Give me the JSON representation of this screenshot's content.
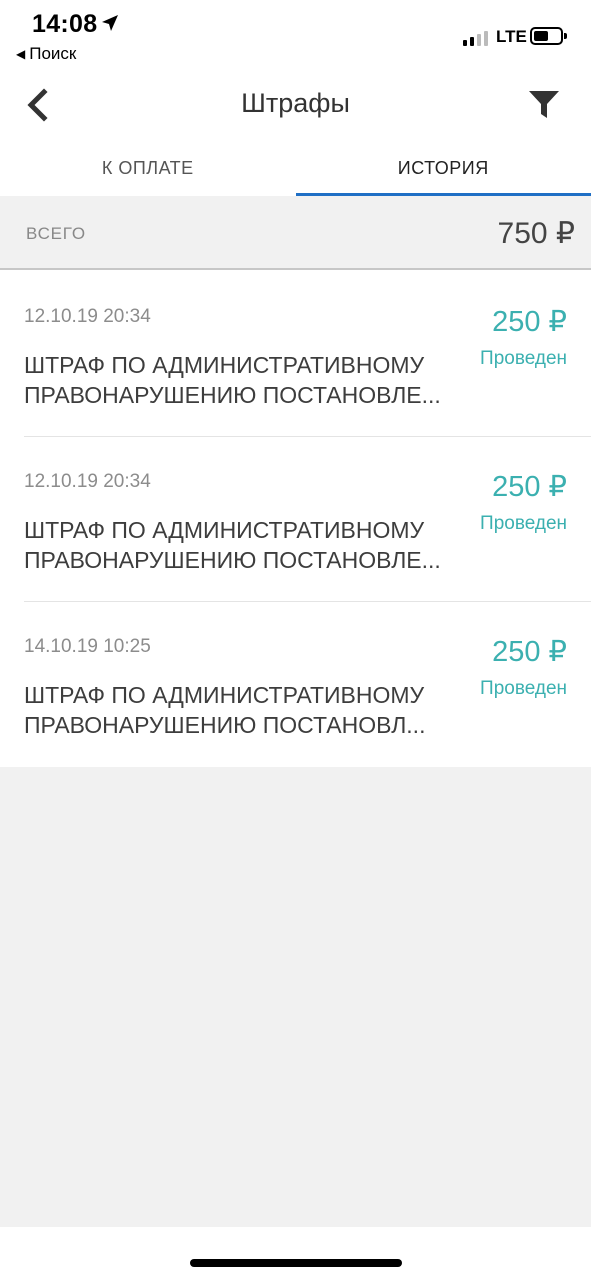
{
  "status_bar": {
    "time": "14:08",
    "back_app": "Поиск",
    "network": "LTE"
  },
  "nav": {
    "title": "Штрафы",
    "back_icon": "chevron-left-icon",
    "filter_icon": "filter-icon"
  },
  "tabs": [
    {
      "label": "К ОПЛАТЕ",
      "active": false
    },
    {
      "label": "ИСТОРИЯ",
      "active": true
    }
  ],
  "total": {
    "label": "ВСЕГО",
    "value": "750 ₽"
  },
  "fines": [
    {
      "date": "12.10.19 20:34",
      "line1": "ШТРАФ ПО АДМИНИСТРАТИВНОМУ",
      "line2": "ПРАВОНАРУШЕНИЮ ПОСТАНОВЛЕ...",
      "amount": "250 ₽",
      "status": "Проведен"
    },
    {
      "date": "12.10.19 20:34",
      "line1": "ШТРАФ ПО АДМИНИСТРАТИВНОМУ",
      "line2": "ПРАВОНАРУШЕНИЮ ПОСТАНОВЛЕ...",
      "amount": "250 ₽",
      "status": "Проведен"
    },
    {
      "date": "14.10.19 10:25",
      "line1": "ШТРАФ ПО АДМИНИСТРАТИВНОМУ",
      "line2": "ПРАВОНАРУШЕНИЮ ПОСТАНОВЛ...",
      "amount": "250 ₽",
      "status": "Проведен"
    }
  ],
  "colors": {
    "accent_teal": "#3bb0b0",
    "tab_indicator": "#1f6fc5",
    "background_gray": "#f1f1f1"
  }
}
